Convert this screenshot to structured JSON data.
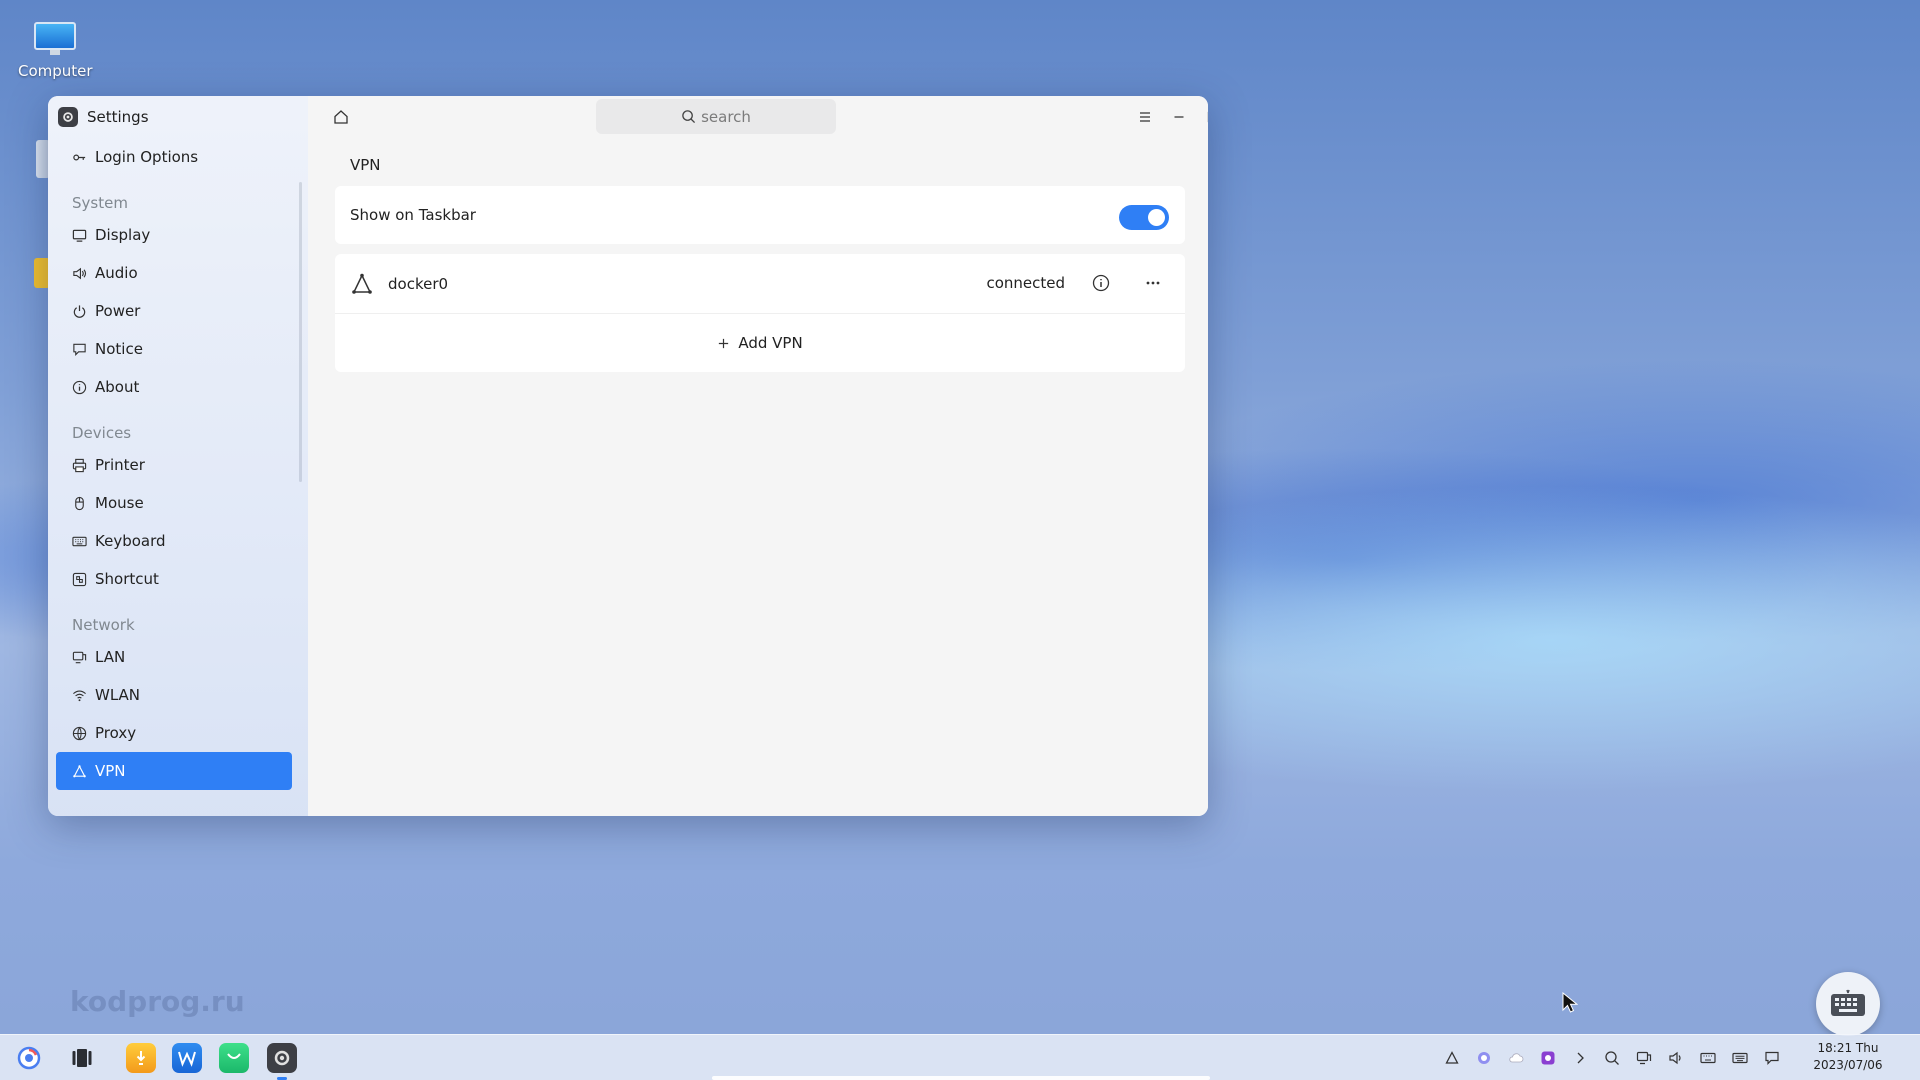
{
  "desktop": {
    "computer_label": "Computer",
    "watermark": "kodprog.ru"
  },
  "window": {
    "app_title": "Settings",
    "search_placeholder": "search"
  },
  "sidebar": {
    "top_item": "Login Options",
    "sections": [
      {
        "title": "System",
        "items": [
          "Display",
          "Audio",
          "Power",
          "Notice",
          "About"
        ]
      },
      {
        "title": "Devices",
        "items": [
          "Printer",
          "Mouse",
          "Keyboard",
          "Shortcut"
        ]
      },
      {
        "title": "Network",
        "items": [
          "LAN",
          "WLAN",
          "Proxy",
          "VPN"
        ]
      }
    ],
    "active_item": "VPN"
  },
  "main": {
    "page_title": "VPN",
    "show_on_taskbar_label": "Show on Taskbar",
    "show_on_taskbar_enabled": true,
    "vpn_connection": {
      "name": "docker0",
      "status": "connected"
    },
    "add_vpn_label": "Add VPN"
  },
  "taskbar": {
    "clock_time": "18:21 Thu",
    "clock_date": "2023/07/06"
  },
  "colors": {
    "accent": "#2f7ff5"
  }
}
